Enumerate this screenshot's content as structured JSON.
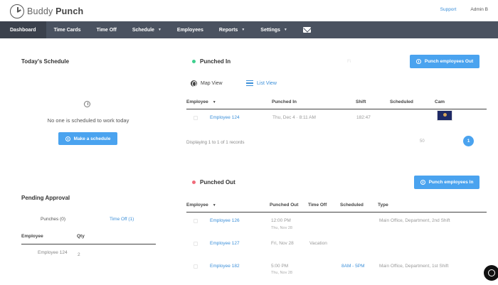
{
  "brand": {
    "name_light": "Buddy",
    "name_bold": "Punch"
  },
  "topbar": {
    "support_label": "Support",
    "user_label": "Admin B"
  },
  "nav": {
    "items": [
      {
        "label": "Dashboard",
        "has_caret": false
      },
      {
        "label": "Time Cards",
        "has_caret": false
      },
      {
        "label": "Time Off",
        "has_caret": false
      },
      {
        "label": "Schedule",
        "has_caret": true
      },
      {
        "label": "Employees",
        "has_caret": false
      },
      {
        "label": "Reports",
        "has_caret": true
      },
      {
        "label": "Settings",
        "has_caret": true
      }
    ],
    "mail_icon": "mail-icon"
  },
  "todays_schedule": {
    "title": "Today's Schedule",
    "empty_message": "No one is scheduled to work today",
    "button_label": "Make a schedule"
  },
  "pending": {
    "title": "Pending Approval",
    "tabs": [
      "Punches (0)",
      "Time Off (1)"
    ],
    "headers": [
      "Employee",
      "Qty"
    ],
    "rows": [
      {
        "employee": "Employee 124",
        "qty": "2"
      }
    ]
  },
  "punched_in": {
    "title": "Punched In",
    "faint_text": "Fi",
    "button_label": "Punch employees Out",
    "views": {
      "map": "Map View",
      "list": "List View"
    },
    "headers": [
      "Employee",
      "Punched In",
      "Shift",
      "Scheduled",
      "Cam"
    ],
    "rows": [
      {
        "employee": "Employee 124",
        "punched_in": "Thu, Dec 4 · 8:11 AM",
        "shift": "182:47",
        "scheduled": ""
      }
    ],
    "footer_text": "Displaying 1 to 1 of 1 records",
    "page_size": "50",
    "current_page": "1"
  },
  "punched_out": {
    "title": "Punched Out",
    "button_label": "Punch employees In",
    "headers": [
      "Employee",
      "Punched Out",
      "Time Off",
      "Scheduled",
      "Type"
    ],
    "rows": [
      {
        "employee": "Employee 126",
        "punched_out": "12:00 PM",
        "punched_out_sub": "Thu, Nov 28",
        "time_off": "",
        "scheduled": "",
        "type": "Main Office, Department, 2nd Shift"
      },
      {
        "employee": "Employee 127",
        "punched_out": "Fri, Nov 28",
        "punched_out_sub": "",
        "time_off": "Vacation",
        "scheduled": "",
        "type": ""
      },
      {
        "employee": "Employee 182",
        "punched_out": "5:00 PM",
        "punched_out_sub": "Thu, Nov 28",
        "time_off": "",
        "scheduled": "8AM - 5PM",
        "type": "Main Office, Department, 1st Shift"
      }
    ]
  },
  "colors": {
    "nav_bg": "#4a5260",
    "nav_active": "#3b414c",
    "accent": "#4aa3ef",
    "link": "#3b8fd9",
    "in_dot": "#3ecf8e",
    "out_dot": "#f06b7a"
  }
}
